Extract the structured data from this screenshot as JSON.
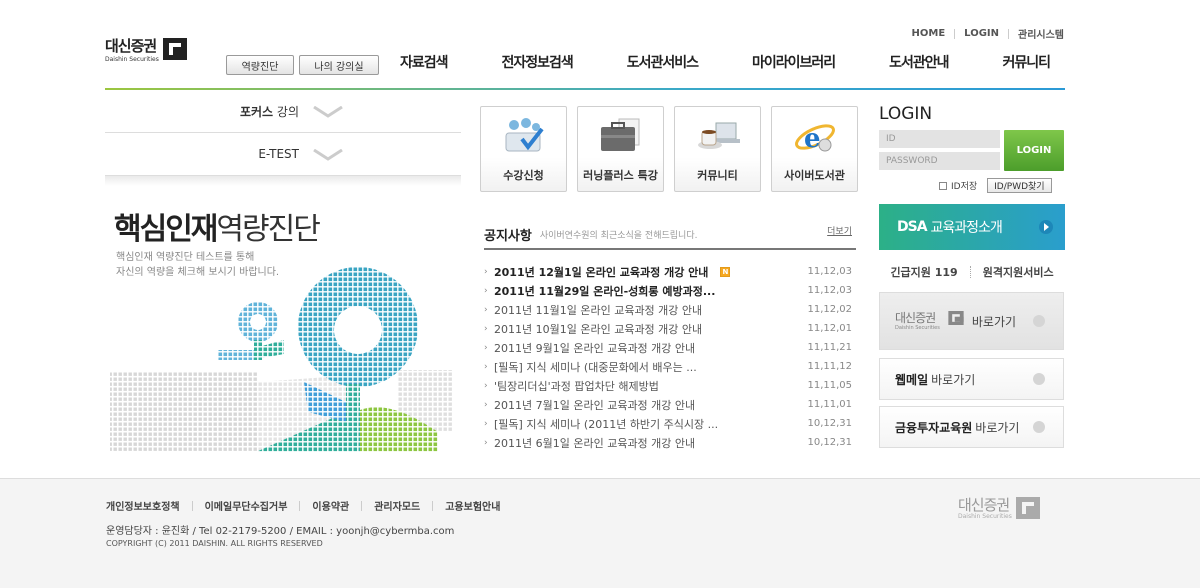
{
  "top_links": [
    "HOME",
    "LOGIN",
    "관리시스템"
  ],
  "logo": {
    "ko": "대신증권",
    "en": "Daishin Securities"
  },
  "sub_buttons": [
    "역량진단",
    "나의 강의실"
  ],
  "gnb": [
    "자료검색",
    "전자정보검색",
    "도서관서비스",
    "마이라이브러리",
    "도서관안내",
    "커뮤니티"
  ],
  "left_menu": [
    {
      "bold": "포커스",
      "rest": " 강의"
    },
    {
      "bold": "",
      "rest": "E-TEST"
    }
  ],
  "visual": {
    "title_bold": "핵심인재",
    "title_light": "역량진단",
    "sub1": "핵심인재 역량진단 테스트를 통해",
    "sub2": "자신의 역량을 체크해 보시기 바랍니다."
  },
  "quick_menu": [
    {
      "label": "수강신청",
      "icon": "users-check-icon"
    },
    {
      "label": "러닝플러스 특강",
      "icon": "briefcase-icon"
    },
    {
      "label": "커뮤니티",
      "icon": "coffee-laptop-icon"
    },
    {
      "label": "사이버도서관",
      "icon": "ie-browser-icon"
    }
  ],
  "notice": {
    "title": "공지사항",
    "desc": "사이버연수원의 최근소식을 전해드립니다.",
    "more": "더보기",
    "items": [
      {
        "title": "2011년 12월1일 온라인 교육과정 개강 안내",
        "date": "11,12,03",
        "bold": true,
        "new": true
      },
      {
        "title": "2011년 11월29일 온라인-성희롱 예방과정...",
        "date": "11,12,03",
        "bold": true,
        "new": false
      },
      {
        "title": "2011년 11월1일 온라인 교육과정 개강 안내",
        "date": "11,12,02",
        "bold": false,
        "new": false
      },
      {
        "title": "2011년 10월1일 온라인 교육과정 개강 안내",
        "date": "11,12,01",
        "bold": false,
        "new": false
      },
      {
        "title": "2011년 9월1일 온라인 교육과정 개강 안내",
        "date": "11,11,21",
        "bold": false,
        "new": false
      },
      {
        "title": "[필독] 지식 세미나 (대중문화에서 배우는 ...",
        "date": "11,11,12",
        "bold": false,
        "new": false
      },
      {
        "title": "'팀장리더십'과정 팝업차단 해제방법",
        "date": "11,11,05",
        "bold": false,
        "new": false
      },
      {
        "title": "2011년 7월1일 온라인 교육과정 개강 안내",
        "date": "11,11,01",
        "bold": false,
        "new": false
      },
      {
        "title": "[필독] 지식 세미나 (2011년 하반기 주식시장 ...",
        "date": "10,12,31",
        "bold": false,
        "new": false
      },
      {
        "title": "2011년 6월1일 온라인 교육과정 개강 안내",
        "date": "10,12,31",
        "bold": false,
        "new": false
      }
    ]
  },
  "login": {
    "title": "LOGIN",
    "id_placeholder": "ID",
    "pw_placeholder": "PASSWORD",
    "button": "LOGIN",
    "save_id": "ID저장",
    "find": "ID/PWD찾기"
  },
  "dsa": {
    "en": "DSA",
    "ko": "교육과정소개"
  },
  "help": [
    "긴급지원 119",
    "원격지원서비스"
  ],
  "go_boxes": [
    {
      "logo_ko": "대신증권",
      "logo_en": "Daishin Securities",
      "rest": "바로가기"
    },
    {
      "bold": "웹메일",
      "rest": "바로가기"
    },
    {
      "bold": "금융투자교육원",
      "rest": "바로가기"
    }
  ],
  "footer": {
    "links": [
      "개인정보보호정책",
      "이메일무단수집거부",
      "이용약관",
      "관리자모드",
      "고용보험안내"
    ],
    "info": "운영담당자 : 윤진화  /  Tel 02-2179-5200 / EMAIL : yoonjh@cybermba.com",
    "copyright": "COPYRIGHT (C) 2011 DAISHIN. ALL RIGHTS RESERVED",
    "logo_ko": "대신증권",
    "logo_en": "Daishin Securities"
  },
  "colors": {
    "accent_green": "#4c9e2b",
    "accent_blue": "#2a9ecd",
    "new_badge": "#f6a821"
  }
}
